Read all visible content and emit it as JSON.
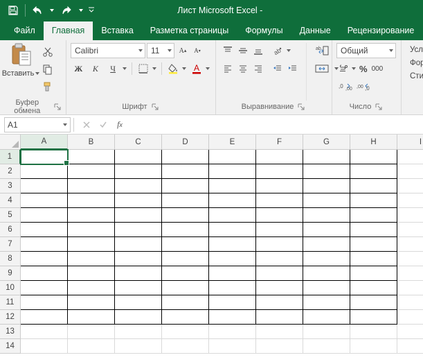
{
  "title": "Лист Microsoft Excel -",
  "tabs": [
    "Файл",
    "Главная",
    "Вставка",
    "Разметка страницы",
    "Формулы",
    "Данные",
    "Рецензирование"
  ],
  "active_tab": 1,
  "clipboard": {
    "paste_label": "Вставить",
    "group_label": "Буфер обмена"
  },
  "font": {
    "name": "Calibri",
    "size": "11",
    "bold": "Ж",
    "italic": "К",
    "underline": "Ч",
    "inc": "A",
    "dec": "A",
    "group_label": "Шрифт"
  },
  "alignment": {
    "group_label": "Выравнивание"
  },
  "number": {
    "format": "Общий",
    "group_label": "Число"
  },
  "styles": {
    "cond": "Усл",
    "table": "Фор",
    "cell": "Сти"
  },
  "namebox": "A1",
  "columns": [
    "A",
    "B",
    "C",
    "D",
    "E",
    "F",
    "G",
    "H",
    "I"
  ],
  "rows": [
    "1",
    "2",
    "3",
    "4",
    "5",
    "6",
    "7",
    "8",
    "9",
    "10",
    "11",
    "12",
    "13",
    "14"
  ],
  "active_cell": {
    "r": 0,
    "c": 0
  },
  "bordered_range": {
    "rows": 12,
    "cols": 8
  }
}
